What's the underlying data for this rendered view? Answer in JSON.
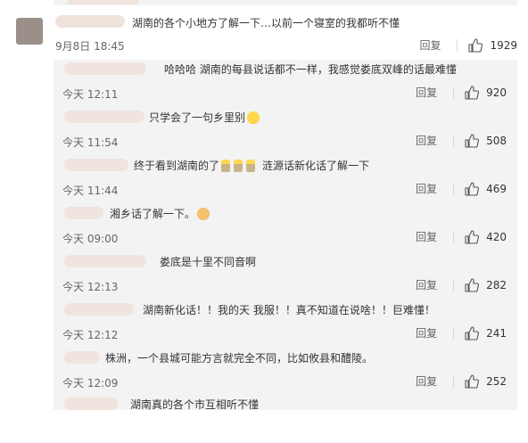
{
  "main_comment": {
    "text": "湖南的各个小地方了解一下…以前一个寝室的我都听不懂",
    "time": "9月8日 18:45",
    "reply_label": "回复",
    "likes": "1929"
  },
  "replies": [
    {
      "text": "哈哈哈  湖南的每县说话都不一样，我感觉娄底双峰的话最难懂",
      "time": "今天 12:11",
      "reply_label": "回复",
      "likes": "920",
      "emojis": []
    },
    {
      "text": "只学会了一句乡里别",
      "time": "今天 11:54",
      "reply_label": "回复",
      "likes": "508",
      "emojis": [
        "laugh-emoji"
      ]
    },
    {
      "text": "终于看到湖南的了",
      "text_after": "涟源话新化话了解一下",
      "time": "今天 11:44",
      "reply_label": "回复",
      "likes": "469",
      "emojis": [
        "candle-emoji",
        "candle-emoji",
        "candle-emoji"
      ]
    },
    {
      "text": "湘乡话了解一下。",
      "time": "今天 09:00",
      "reply_label": "回复",
      "likes": "420",
      "emojis": [
        "dog-emoji"
      ]
    },
    {
      "text": "娄底是十里不同音啊",
      "time": "今天 12:13",
      "reply_label": "回复",
      "likes": "282",
      "emojis": []
    },
    {
      "text": "湖南新化话！！我的天 我服！！真不知道在说啥！！巨难懂！",
      "time": "今天 12:12",
      "reply_label": "回复",
      "likes": "241",
      "emojis": []
    },
    {
      "text": "株洲，一个县城可能方言就完全不同，比如攸县和醴陵。",
      "time": "今天 12:09",
      "reply_label": "回复",
      "likes": "252",
      "emojis": []
    },
    {
      "text": "湖南真的各个市互相听不懂",
      "time": "",
      "reply_label": "",
      "likes": "",
      "emojis": []
    }
  ]
}
